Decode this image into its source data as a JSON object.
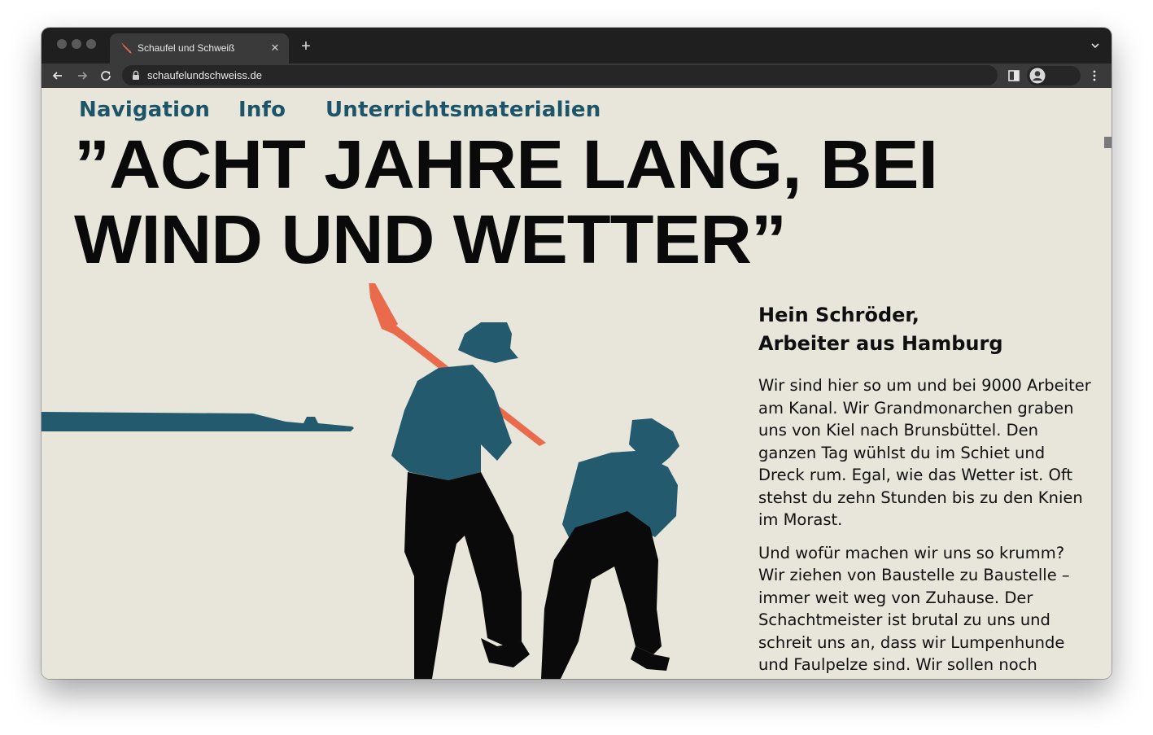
{
  "browser": {
    "tab_title": "Schaufel und Schweiß",
    "url": "schaufelundschweiss.de",
    "icons": [
      "shovel-favicon-icon",
      "close-icon",
      "plus-icon",
      "chevron-down-icon",
      "arrow-left-icon",
      "arrow-right-icon",
      "reload-icon",
      "lock-icon",
      "side-panel-icon",
      "profile-icon",
      "kebab-menu-icon"
    ]
  },
  "nav": {
    "items": [
      {
        "label": "Navigation"
      },
      {
        "label": "Info"
      },
      {
        "label": "Unterrichtsmaterialien"
      }
    ]
  },
  "headline": {
    "line1": "”ACHT JAHRE LANG, BEI",
    "line2": "WIND UND WETTER”"
  },
  "speaker": {
    "name_line1": "Hein Schröder,",
    "name_line2": "Arbeiter aus Hamburg"
  },
  "body": {
    "paragraphs": [
      "Wir sind hier so um und bei 9000 Arbeiter am Kanal. Wir Grandmonarchen graben uns von Kiel nach Brunsbüttel. Den ganzen Tag wühlst du im Schiet und Dreck rum. Egal, wie das Wetter ist. Oft stehst du zehn Stunden bis zu den Knien im Morast.",
      "Und wofür machen wir uns so krumm? Wir ziehen von Baustelle zu Baustelle – immer weit weg von Zuhause. Der Schachtmeister ist brutal zu uns und schreit uns an, dass wir Lumpenhunde und Faulpelze sind. Wir sollen noch"
    ]
  },
  "colors": {
    "page_bg": "#e8e5da",
    "nav_text": "#1c5468",
    "shirt_teal": "#235a6e",
    "shovel_orange": "#e96b4c",
    "trousers": "#0a0a0a"
  }
}
